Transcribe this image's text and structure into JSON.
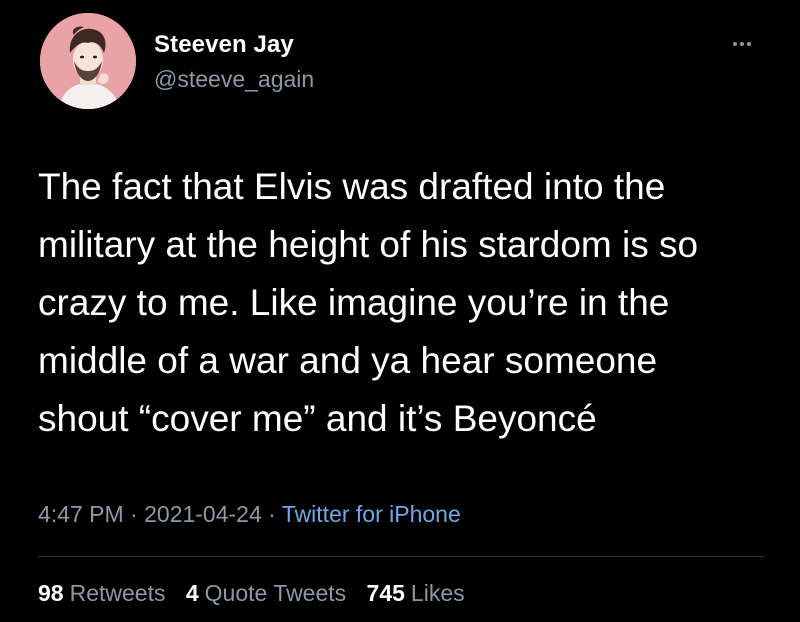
{
  "author": {
    "display_name": "Steeven Jay",
    "handle": "@steeve_again",
    "avatar_icon": "avatar-illustration",
    "avatar_bg": "#e9a3a7"
  },
  "more_icon": "more-horizontal-icon",
  "tweet": {
    "text": "The fact that Elvis was drafted into the\nmilitary at the height of his stardom is so\ncrazy to me. Like imagine you’re in the\nmiddle of a war and ya hear someone\nshout “cover me” and it’s Beyoncé"
  },
  "meta": {
    "time": "4:47 PM",
    "sep1": " · ",
    "date": "2021-04-24",
    "sep2": " · ",
    "source": "Twitter for iPhone"
  },
  "stats": {
    "retweets_count": "98",
    "retweets_label": "Retweets",
    "quotes_count": "4",
    "quotes_label": "Quote Tweets",
    "likes_count": "745",
    "likes_label": "Likes"
  },
  "colors": {
    "background": "#000000",
    "text": "#ffffff",
    "muted": "#8b98a5",
    "link": "#6ea8e5",
    "divider": "#2f3336"
  }
}
